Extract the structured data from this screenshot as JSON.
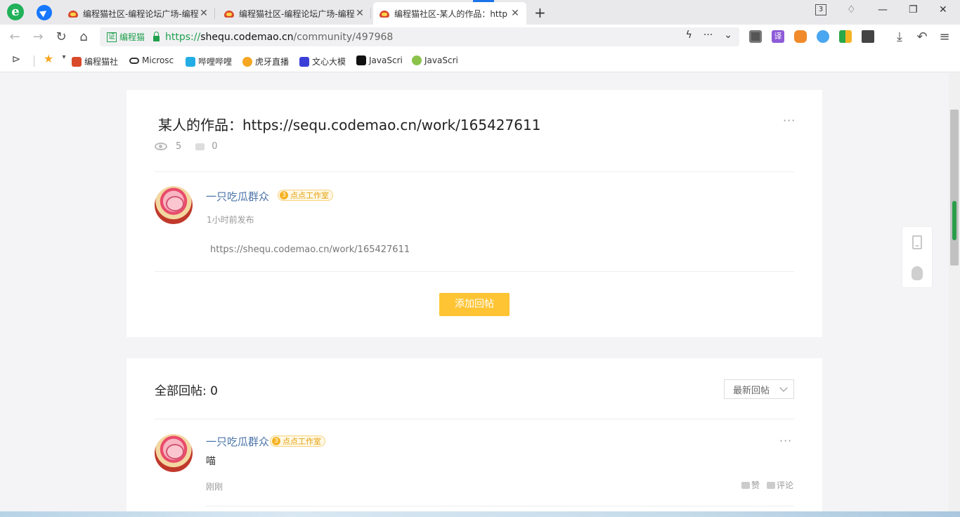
{
  "browser": {
    "tabs": [
      {
        "title": "编程猫社区-编程论坛广场-编程",
        "active": false
      },
      {
        "title": "编程猫社区-编程论坛广场-编程",
        "active": false
      },
      {
        "title": "编程猫社区-某人的作品：http",
        "active": true
      }
    ],
    "tab_counter": "3",
    "address": {
      "cert_label": "证",
      "cert_name": "编程猫",
      "scheme": "https://",
      "host": "shequ.codemao.cn",
      "path": "/community/497968"
    },
    "bookmarks": [
      {
        "label": "编程猫社",
        "color": "#d94a2b"
      },
      {
        "label": "Microsc",
        "color": "#333333"
      },
      {
        "label": "哔哩哔哩",
        "color": "#23ade5"
      },
      {
        "label": "虎牙直播",
        "color": "#f5a623"
      },
      {
        "label": "文心大模",
        "color": "#3b3fd8"
      },
      {
        "label": "JavaScri",
        "color": "#111111"
      },
      {
        "label": "JavaScri",
        "color": "#8bc34a"
      }
    ]
  },
  "post": {
    "title": "某人的作品：https://sequ.codemao.cn/work/165427611",
    "views": "5",
    "comments": "0",
    "author": {
      "name": "一只吃瓜群众",
      "badge_level": "3",
      "badge_label": "点点工作室"
    },
    "published": "1小时前发布",
    "body": "https://shequ.codemao.cn/work/165427611",
    "reply_button": "添加回帖"
  },
  "replies": {
    "heading": "全部回帖: 0",
    "sort": "最新回帖",
    "items": [
      {
        "author": "一只吃瓜群众",
        "badge_level": "3",
        "badge_label": "点点工作室",
        "text": "喵",
        "time": "刚刚",
        "like_label": "赞",
        "comment_label": "评论"
      }
    ]
  },
  "colors": {
    "accent": "#fec433",
    "link": "#4b74a8",
    "secure": "#20a04d"
  }
}
